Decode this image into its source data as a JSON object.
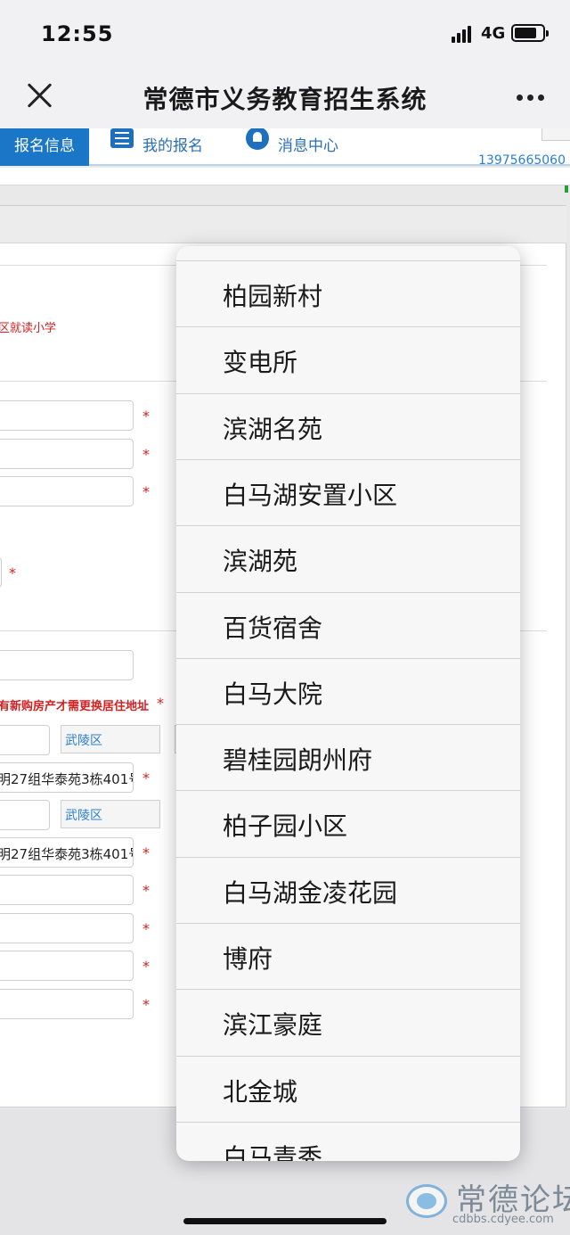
{
  "status_bar": {
    "time": "12:55",
    "network": "4G",
    "battery_level": 0.8
  },
  "nav_bar": {
    "title": "常德市义务教育招生系统",
    "close_icon": "close-icon",
    "more_icon": "more-dots-icon"
  },
  "tabs": [
    {
      "label": "报名信息",
      "active": true
    },
    {
      "label": "我的报名",
      "icon": "list-icon"
    },
    {
      "label": "消息中心",
      "icon": "bell-icon"
    }
  ],
  "user_phone": "13975665060",
  "form": {
    "school_hint": "区就读小学",
    "address_hint": "有新购房产才需更换居住地址",
    "district_1": "武陵区",
    "address_1": "明27组华泰苑3栋401号",
    "district_2": "武陵区",
    "address_2": "明27组华泰苑3栋401号",
    "required_mark": "*"
  },
  "dropdown": {
    "options": [
      "柏园新村",
      "变电所",
      "滨湖名苑",
      "白马湖安置小区",
      "滨湖苑",
      "百货宿舍",
      "白马大院",
      "碧桂园朗州府",
      "柏子园小区",
      "白马湖金凌花园",
      "博府",
      "滨江豪庭",
      "北金城",
      "白马青秀"
    ]
  },
  "watermark": {
    "title": "常德论坛",
    "url": "cdbbs.cdyee.com"
  }
}
